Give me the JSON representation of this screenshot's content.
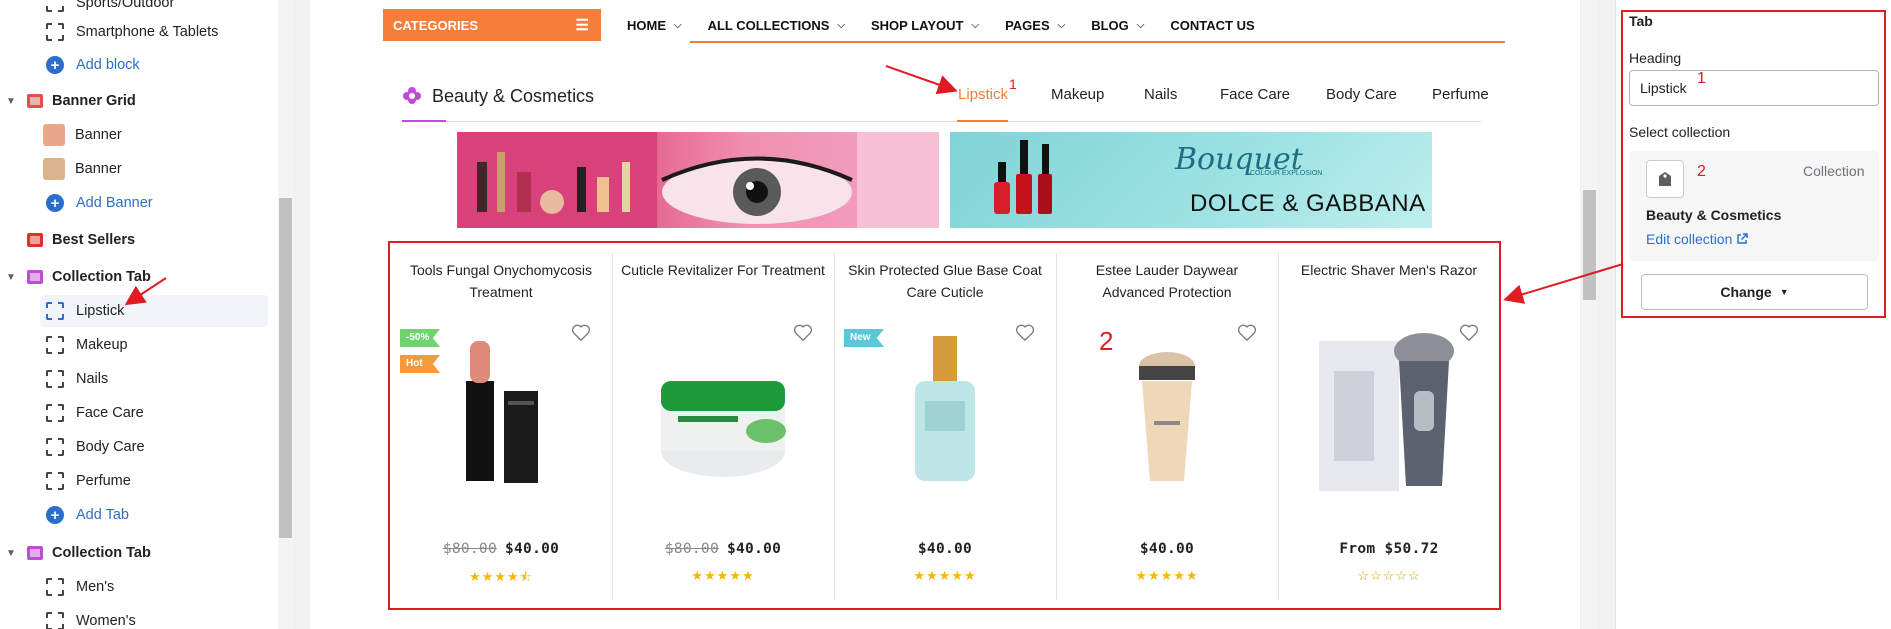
{
  "sidebar": {
    "items": [
      {
        "kind": "child",
        "label": "Sports/Outdoor"
      },
      {
        "kind": "child",
        "label": "Smartphone & Tablets"
      },
      {
        "kind": "add",
        "label": "Add block"
      },
      {
        "kind": "section",
        "label": "Banner Grid",
        "icon": "banner-grid-icon"
      },
      {
        "kind": "thumb",
        "label": "Banner"
      },
      {
        "kind": "thumb",
        "label": "Banner"
      },
      {
        "kind": "add",
        "label": "Add Banner"
      },
      {
        "kind": "section-nocaret",
        "label": "Best Sellers",
        "icon": "best-sellers-icon"
      },
      {
        "kind": "section",
        "label": "Collection Tab",
        "icon": "collection-tab-icon"
      },
      {
        "kind": "child",
        "label": "Lipstick",
        "selected": true
      },
      {
        "kind": "child",
        "label": "Makeup"
      },
      {
        "kind": "child",
        "label": "Nails"
      },
      {
        "kind": "child",
        "label": "Face Care"
      },
      {
        "kind": "child",
        "label": "Body Care"
      },
      {
        "kind": "child",
        "label": "Perfume"
      },
      {
        "kind": "add",
        "label": "Add Tab"
      },
      {
        "kind": "section",
        "label": "Collection Tab",
        "icon": "collection-tab-icon"
      },
      {
        "kind": "child",
        "label": "Men's"
      },
      {
        "kind": "child",
        "label": "Women's"
      }
    ]
  },
  "nav": {
    "categories_label": "CATEGORIES",
    "items": [
      {
        "label": "HOME",
        "has_dropdown": true
      },
      {
        "label": "ALL COLLECTIONS",
        "has_dropdown": true
      },
      {
        "label": "SHOP LAYOUT",
        "has_dropdown": true
      },
      {
        "label": "PAGES",
        "has_dropdown": true
      },
      {
        "label": "BLOG",
        "has_dropdown": true
      },
      {
        "label": "CONTACT US",
        "has_dropdown": false
      }
    ]
  },
  "section": {
    "title": "Beauty & Cosmetics",
    "tabs": [
      "Lipstick",
      "Makeup",
      "Nails",
      "Face Care",
      "Body Care",
      "Perfume"
    ],
    "active_tab": "Lipstick"
  },
  "banners": {
    "banner2_script": "Bouquet",
    "banner2_sub": "COLOUR EXPLOSION",
    "banner2_brand": "DOLCE & GABBANA"
  },
  "products": [
    {
      "title": "Tools Fungal Onychomycosis Treatment",
      "old_price": "$80.00",
      "price": "$40.00",
      "rating": 4.5,
      "badges": [
        {
          "text": "-50%",
          "color": "#6fd36f"
        },
        {
          "text": "Hot",
          "color": "#f59a3a"
        }
      ]
    },
    {
      "title": "Cuticle Revitalizer For Treatment",
      "old_price": "$80.00",
      "price": "$40.00",
      "rating": 5,
      "badges": []
    },
    {
      "title": "Skin Protected Glue Base Coat Care Cuticle",
      "old_price": "",
      "price": "$40.00",
      "rating": 5,
      "badges": [
        {
          "text": "New",
          "color": "#5bc8d8"
        }
      ]
    },
    {
      "title": "Estee Lauder Daywear Advanced Protection",
      "old_price": "",
      "price": "$40.00",
      "rating": 5,
      "badges": []
    },
    {
      "title": "Electric Shaver Men's Razor",
      "old_price": "",
      "price": "From $50.72",
      "rating": 0,
      "badges": []
    }
  ],
  "annotations": {
    "tab_marker": "1",
    "grid_marker": "2",
    "heading_marker": "1",
    "collection_marker": "2"
  },
  "panel": {
    "title": "Tab",
    "heading_label": "Heading",
    "heading_value": "Lipstick",
    "select_label": "Select collection",
    "collection_type": "Collection",
    "collection_name": "Beauty & Cosmetics",
    "edit_link": "Edit collection",
    "change_button": "Change"
  },
  "colors": {
    "accent_orange": "#f47e3a",
    "link_blue": "#2c6ecb",
    "annotation_red": "#e01b22",
    "star_yellow": "#f5b700"
  }
}
